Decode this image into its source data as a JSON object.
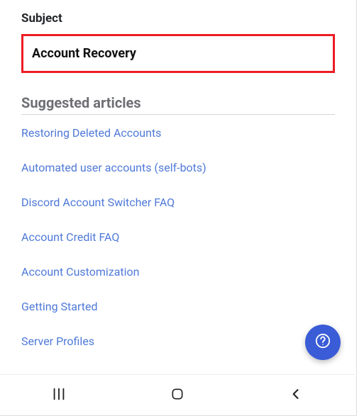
{
  "subject": {
    "label": "Subject",
    "value": "Account Recovery"
  },
  "suggested": {
    "title": "Suggested articles",
    "items": [
      "Restoring Deleted Accounts",
      "Automated user accounts (self-bots)",
      "Discord Account Switcher FAQ",
      "Account Credit FAQ",
      "Account Customization",
      "Getting Started",
      "Server Profiles"
    ]
  },
  "colors": {
    "highlight_border": "#ed1c24",
    "link": "#4f79d8",
    "fab": "#3a5cd6"
  }
}
